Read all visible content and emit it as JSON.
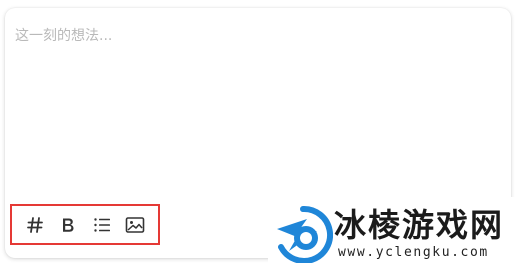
{
  "editor": {
    "placeholder": "这一刻的想法...",
    "value": ""
  },
  "toolbar": {
    "buttons": [
      {
        "icon": "hashtag-icon",
        "glyph": "#"
      },
      {
        "icon": "bold-icon",
        "glyph": "B"
      },
      {
        "icon": "list-icon",
        "glyph": "list"
      },
      {
        "icon": "image-icon",
        "glyph": "image"
      }
    ],
    "highlight_color": "#e53935"
  },
  "watermark": {
    "title": "冰棱游戏网",
    "url": "www.yclengku.com",
    "brand_color": "#1f86d8"
  }
}
